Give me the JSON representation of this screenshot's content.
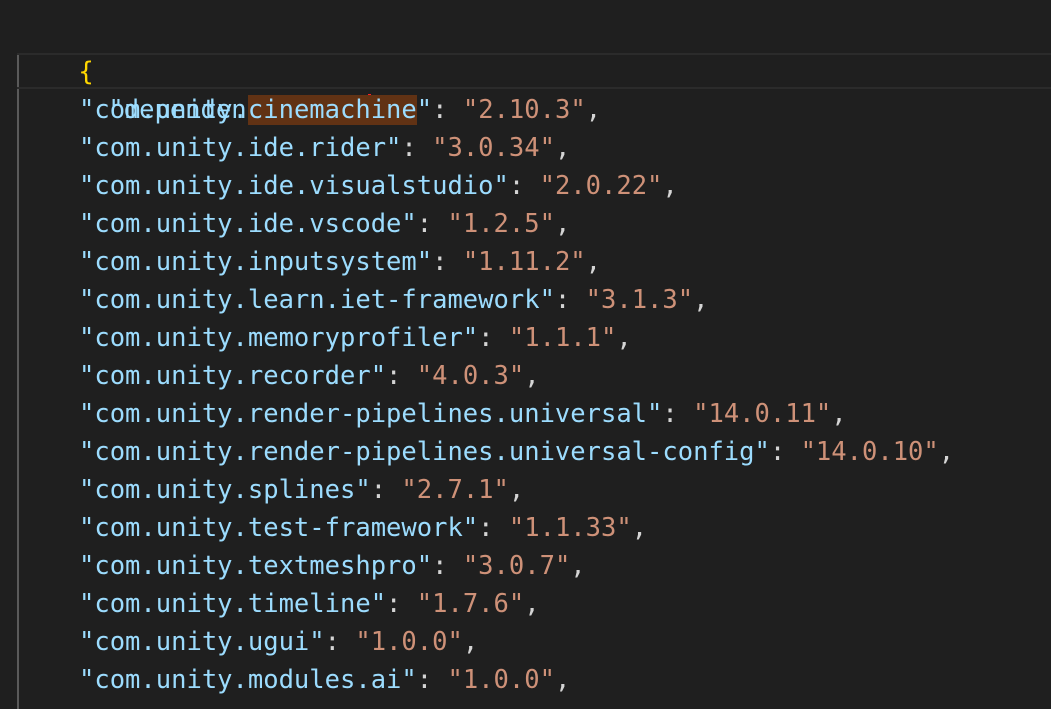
{
  "editor": {
    "open_brace": "{",
    "dependencies_key": "\"dependencies\"",
    "colon_space": ": ",
    "inner_open_brace": "{",
    "highlighted_word": "cinemachine",
    "entries": [
      {
        "key_prefix": "\"com.unity.",
        "key_hl": "cinemachine",
        "key_suffix": "\"",
        "value": "\"2.10.3\""
      },
      {
        "key": "\"com.unity.ide.rider\"",
        "value": "\"3.0.34\""
      },
      {
        "key": "\"com.unity.ide.visualstudio\"",
        "value": "\"2.0.22\""
      },
      {
        "key": "\"com.unity.ide.vscode\"",
        "value": "\"1.2.5\""
      },
      {
        "key": "\"com.unity.inputsystem\"",
        "value": "\"1.11.2\""
      },
      {
        "key": "\"com.unity.learn.iet-framework\"",
        "value": "\"3.1.3\""
      },
      {
        "key": "\"com.unity.memoryprofiler\"",
        "value": "\"1.1.1\""
      },
      {
        "key": "\"com.unity.recorder\"",
        "value": "\"4.0.3\""
      },
      {
        "key": "\"com.unity.render-pipelines.universal\"",
        "value": "\"14.0.11\""
      },
      {
        "key": "\"com.unity.render-pipelines.universal-config\"",
        "value": "\"14.0.10\""
      },
      {
        "key": "\"com.unity.splines\"",
        "value": "\"2.7.1\""
      },
      {
        "key": "\"com.unity.test-framework\"",
        "value": "\"1.1.33\""
      },
      {
        "key": "\"com.unity.textmeshpro\"",
        "value": "\"3.0.7\""
      },
      {
        "key": "\"com.unity.timeline\"",
        "value": "\"1.7.6\""
      },
      {
        "key": "\"com.unity.ugui\"",
        "value": "\"1.0.0\""
      },
      {
        "key": "\"com.unity.modules.ai\"",
        "value": "\"1.0.0\""
      }
    ],
    "comma": ","
  }
}
